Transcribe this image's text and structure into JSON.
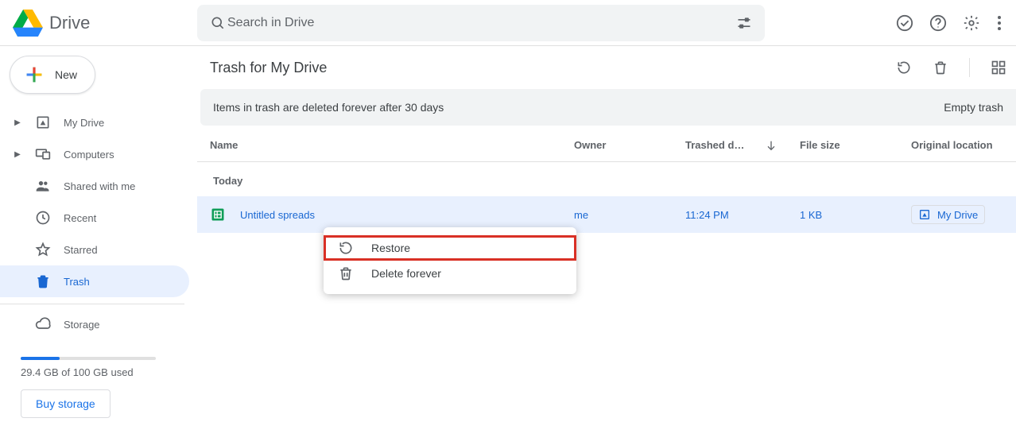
{
  "header": {
    "app_name": "Drive",
    "search_placeholder": "Search in Drive"
  },
  "sidebar": {
    "new_label": "New",
    "items": [
      {
        "label": "My Drive"
      },
      {
        "label": "Computers"
      },
      {
        "label": "Shared with me"
      },
      {
        "label": "Recent"
      },
      {
        "label": "Starred"
      },
      {
        "label": "Trash"
      }
    ],
    "storage_label": "Storage",
    "storage_used_text": "29.4 GB of 100 GB used",
    "buy_label": "Buy storage"
  },
  "content": {
    "page_title": "Trash for My Drive",
    "banner_text": "Items in trash are deleted forever after 30 days",
    "empty_trash_label": "Empty trash",
    "columns": {
      "name": "Name",
      "owner": "Owner",
      "trashed": "Trashed d…",
      "size": "File size",
      "location": "Original location"
    },
    "group_label": "Today",
    "rows": [
      {
        "name": "Untitled spreads",
        "owner": "me",
        "trashed_date": "11:24 PM",
        "size": "1 KB",
        "location": "My Drive"
      }
    ]
  },
  "context_menu": {
    "restore": "Restore",
    "delete_forever": "Delete forever"
  }
}
